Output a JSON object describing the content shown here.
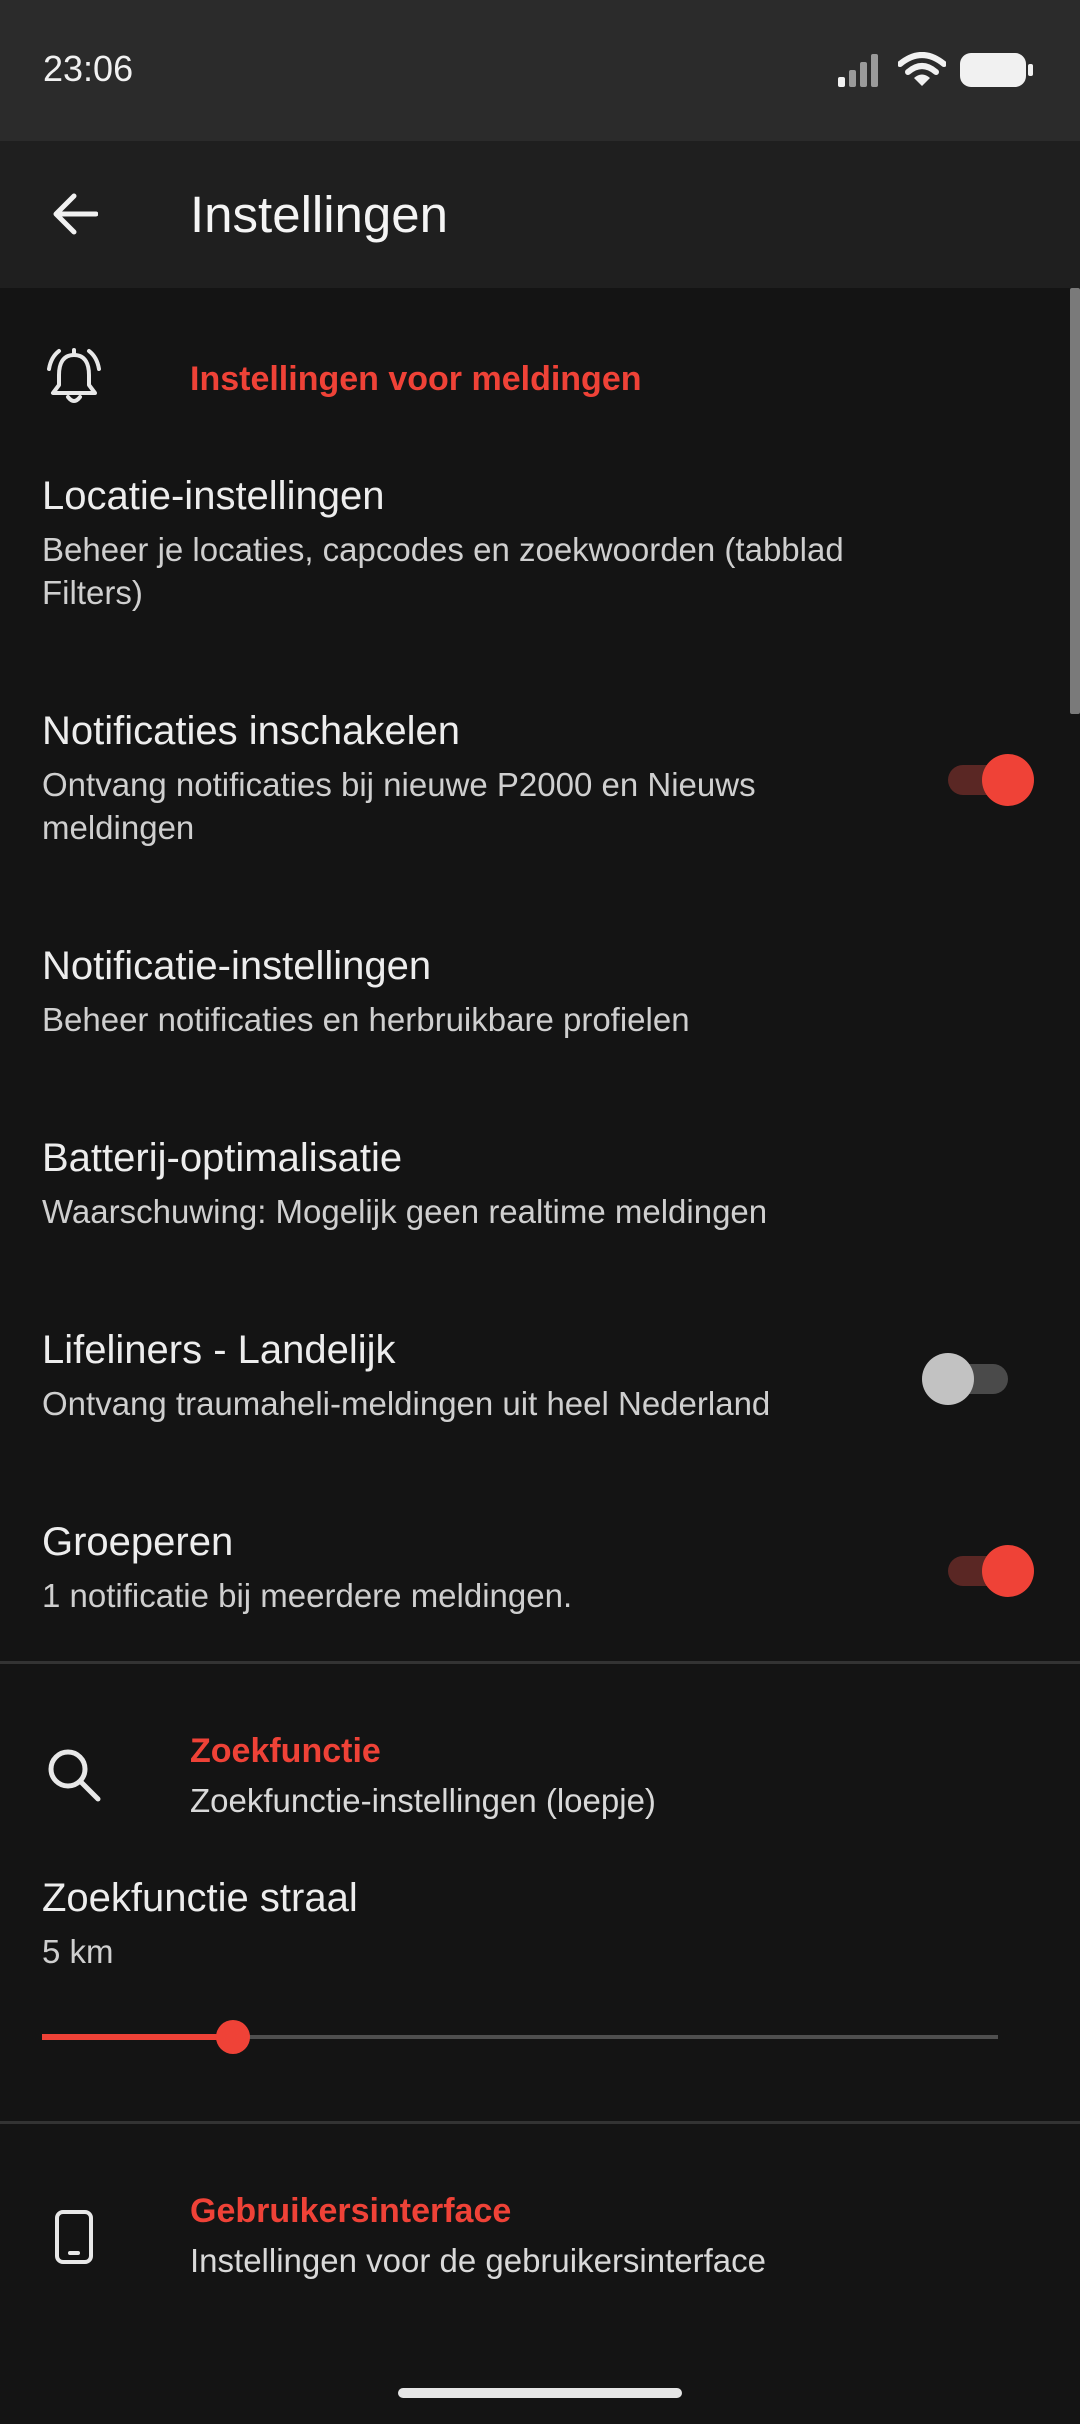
{
  "status_bar": {
    "time": "23:06",
    "icons": [
      "signal-icon",
      "wifi-icon",
      "battery-icon"
    ]
  },
  "app_bar": {
    "title": "Instellingen",
    "back_icon": "arrow-back-icon"
  },
  "sections": {
    "notifications": {
      "icon": "bell-icon",
      "title": "Instellingen voor meldingen"
    },
    "search": {
      "icon": "search-icon",
      "title": "Zoekfunctie",
      "summary": "Zoekfunctie-instellingen (loepje)"
    },
    "ui": {
      "icon": "phone-icon",
      "title": "Gebruikersinterface",
      "summary": "Instellingen voor de gebruikersinterface"
    }
  },
  "prefs": {
    "location": {
      "title": "Locatie-instellingen",
      "summary_line1": "Beheer je locaties, capcodes en zoekwoorden (tabblad",
      "summary_line2": "Filters)"
    },
    "enable_notifications": {
      "title": "Notificaties inschakelen",
      "summary_line1": "Ontvang notificaties bij nieuwe P2000 en Nieuws",
      "summary_line2": "meldingen",
      "checked": true
    },
    "notification_settings": {
      "title": "Notificatie-instellingen",
      "summary": "Beheer notificaties en herbruikbare profielen"
    },
    "battery": {
      "title": "Batterij-optimalisatie",
      "summary": "Waarschuwing: Mogelijk geen realtime meldingen"
    },
    "lifeliners": {
      "title": "Lifeliners - Landelijk",
      "summary": "Ontvang traumaheli-meldingen uit heel Nederland",
      "checked": false
    },
    "grouping": {
      "title": "Groeperen",
      "summary": "1 notificatie bij meerdere meldingen.",
      "checked": true
    },
    "search_radius": {
      "title": "Zoekfunctie straal",
      "value_text": "5 km",
      "slider_fraction": 0.2
    }
  },
  "colors": {
    "accent": "#ef4237",
    "background": "#141414",
    "app_bar": "#1f1f1f",
    "status_bar": "#2b2b2b"
  }
}
